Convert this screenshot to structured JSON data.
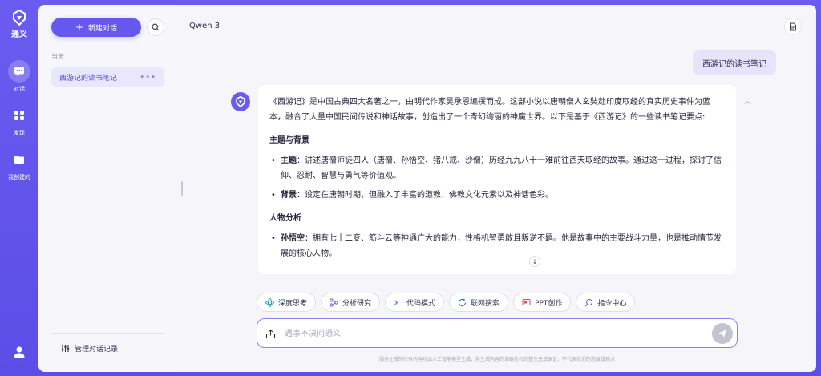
{
  "rail": {
    "brand": "通义",
    "items": [
      {
        "label": "对话",
        "icon": "chat-bubble-icon",
        "active": true
      },
      {
        "label": "发现",
        "icon": "grid-icon",
        "active": false
      },
      {
        "label": "我创建的",
        "icon": "folder-icon",
        "active": false
      }
    ]
  },
  "sidebar": {
    "new_chat_label": "新建对话",
    "section_today": "当天",
    "conversations": [
      {
        "title": "西游记的读书笔记"
      }
    ],
    "manage_label": "管理对话记录"
  },
  "chat": {
    "model_name": "Qwen 3",
    "user_message": "西游记的读书笔记",
    "answer": {
      "intro": "《西游记》是中国古典四大名著之一，由明代作家吴承恩编撰而成。这部小说以唐朝僧人玄奘赴印度取经的真实历史事件为蓝本，融合了大量中国民间传说和神话故事，创造出了一个奇幻绚丽的神魔世界。以下是基于《西游记》的一些读书笔记要点:",
      "section1_title": "主题与背景",
      "section1_items": [
        {
          "term": "主题",
          "text": "：讲述唐僧师徒四人（唐僧、孙悟空、猪八戒、沙僧）历经九九八十一难前往西天取经的故事。通过这一过程，探讨了信仰、忍耐、智慧与勇气等价值观。"
        },
        {
          "term": "背景",
          "text": "：设定在唐朝时期，但融入了丰富的道教、佛教文化元素以及神话色彩。"
        }
      ],
      "section2_title": "人物分析",
      "section2_items": [
        {
          "term": "孙悟空",
          "text": "：拥有七十二变、筋斗云等神通广大的能力，性格机智勇敢且叛逆不羁。他是故事中的主要战斗力量，也是推动情节发展的核心人物。"
        }
      ]
    },
    "tools": [
      {
        "label": "深度思考",
        "icon": "atom-icon",
        "color": "#19a9b0"
      },
      {
        "label": "分析研究",
        "icon": "nodes-icon",
        "color": "#6a5cf0"
      },
      {
        "label": "代码模式",
        "icon": "terminal-icon",
        "color": "#3d6fe0"
      },
      {
        "label": "联网搜索",
        "icon": "globe-refresh-icon",
        "color": "#2a7be0"
      },
      {
        "label": "PPT创作",
        "icon": "slides-icon",
        "color": "#e0456b"
      },
      {
        "label": "指令中心",
        "icon": "command-icon",
        "color": "#6a5cf0"
      }
    ],
    "input_placeholder": "遇事不决问通义",
    "disclaimer": "服务生成的所有内容均由人工智能模型生成，其生成内容的准确性和完整性无法保证，不代表我们的态度或观点"
  }
}
